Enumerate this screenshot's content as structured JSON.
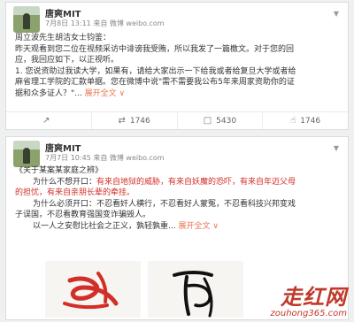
{
  "posts": [
    {
      "author": "唐爽MIT",
      "meta": "7月8日 13:11 来自 微博 weibo.com",
      "lines": [
        "周立波先生胡洁女士钧鉴：",
        "昨天观看到您二位在视频采访中诽谤我受贿，所以我发了一篇檄文。对于您的回",
        "应，我回应如下，以正视听。",
        "1. 您说资助过我读大学，如果有，请给大家出示一下给我或者给复旦大学或者给",
        "麻省理工学院的汇款单据。您在微博中说\"需不需要我公布5年来周家资助你的证",
        "据和众多证人？\"..."
      ],
      "expand": "展开全文",
      "actions": [
        {
          "icon": "share-icon",
          "label": ""
        },
        {
          "icon": "repost-icon",
          "label": "1746"
        },
        {
          "icon": "comment-icon",
          "label": "5430"
        },
        {
          "icon": "like-icon",
          "label": "1746"
        }
      ]
    },
    {
      "author": "唐爽MIT",
      "meta": "7月7日 10:45 来自 微博 weibo.com",
      "title": "《关于某案某家庭之辨》",
      "line1_lead": "为什么不想开口：",
      "line1_red": "有来自地狱的威胁，有来自妖魔的恐吓，有来自年迈父母",
      "line2_red": "的担忧，有来自亲朋长辈的牵挂。",
      "line3_lead": "为什么必须开口：",
      "line3_rest": "不忍看奸人横行，不忍看好人蒙冤，不忍看科技兴邦变戏",
      "line4": "子误国，不忍看教育强国变诈骗毁人。",
      "line5": "以一人之安慰比社会之正义，孰轻孰重...",
      "expand": "展开全文"
    }
  ],
  "watermark": {
    "main": "走红网",
    "sub": "zouhong365.com"
  },
  "colors": {
    "accent_link": "#eb7350",
    "emphasis_red": "#d12f27",
    "watermark_red": "#c0392b"
  }
}
